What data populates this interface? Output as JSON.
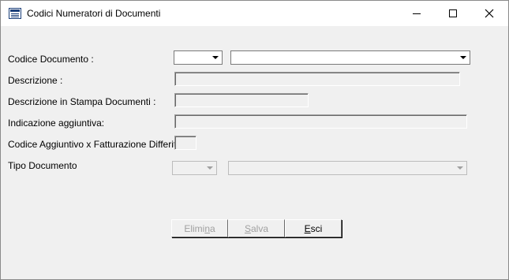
{
  "window": {
    "title": "Codici Numeratori di Documenti"
  },
  "icons": {
    "app": "form-window-icon",
    "minimize": "minimize-icon",
    "maximize": "maximize-icon",
    "close": "close-icon"
  },
  "form": {
    "codice_documento_label": "Codice Documento  :",
    "descrizione_label": "Descrizione  :",
    "descrizione_stampa_label": "Descrizione  in Stampa Documenti  :",
    "indicazione_label": "Indicazione aggiuntiva:",
    "codice_aggiuntivo_label": "Codice Aggiuntivo x Fatturazione Differita :",
    "tipo_documento_label": "Tipo Documento",
    "codice_documento_value": "",
    "codice_documento_desc_value": "",
    "descrizione_value": "",
    "descrizione_stampa_value": "",
    "indicazione_value": "",
    "codice_aggiuntivo_value": "",
    "tipo_documento_value": "",
    "tipo_documento_desc_value": ""
  },
  "buttons": {
    "elimina": {
      "pre": "Elimi",
      "accel": "n",
      "post": "a",
      "enabled": false
    },
    "salva": {
      "pre": "",
      "accel": "S",
      "post": "alva",
      "enabled": false
    },
    "esci": {
      "pre": "",
      "accel": "E",
      "post": "sci",
      "enabled": true
    }
  },
  "colors": {
    "window_bg": "#f0f0f0",
    "titlebar_bg": "#ffffff",
    "disabled_text": "#a0a0a0"
  }
}
